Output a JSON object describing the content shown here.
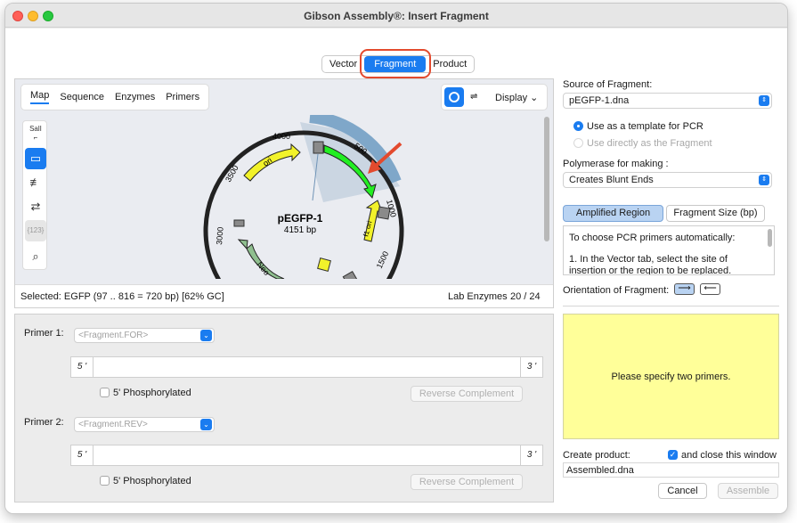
{
  "window": {
    "title": "Gibson Assembly®: Insert Fragment"
  },
  "segments": {
    "vector": "Vector",
    "fragment": "Fragment",
    "product": "Product"
  },
  "map": {
    "tabs": [
      "Map",
      "Sequence",
      "Enzymes",
      "Primers"
    ],
    "display_label": "Display",
    "linear_symbol": "⇌",
    "tool_labels": {
      "sall": "SalI",
      "numbers": "{123}"
    },
    "plasmid_name": "pEGFP-1",
    "plasmid_size": "4151 bp",
    "features": {
      "ori": "ori",
      "neo": "Neo",
      "f1ori": "f1 ori"
    },
    "ticks": {
      "t1000": "1000",
      "t1500": "1500",
      "t3000": "3000",
      "t3500": "3500",
      "t4000": "4000",
      "t500": "500"
    },
    "status_selected": "Selected:  EGFP  (97 .. 816  =  720 bp)     [62% GC]",
    "status_enzymes": "Lab Enzymes",
    "status_count": "20 / 24",
    "colors": {
      "egfp": "#22ee22",
      "ori": "#f2f22a",
      "neo": "#8fbf8f",
      "arc": "#7fa7c9"
    }
  },
  "primers": {
    "primer1_label": "Primer 1:",
    "primer1_placeholder": "<Fragment.FOR>",
    "primer2_label": "Primer 2:",
    "primer2_placeholder": "<Fragment.REV>",
    "five_prime": "5 '",
    "three_prime": "3 '",
    "phosphorylated": "5' Phosphorylated",
    "reverse_complement": "Reverse Complement"
  },
  "right": {
    "source_label": "Source of Fragment:",
    "source_value": "pEGFP-1.dna",
    "radio_template": "Use as a template for PCR",
    "radio_direct": "Use directly as the Fragment",
    "polymerase_label": "Polymerase for making :",
    "polymerase_value": "Creates Blunt Ends",
    "tab_amplified": "Amplified Region",
    "tab_fragment_size": "Fragment Size (bp)",
    "info_line1": "To choose PCR primers automatically:",
    "info_line2": "1. In the Vector tab, select the site of insertion or the region to be replaced.",
    "orientation_label": "Orientation of Fragment:",
    "message": "Please specify two primers.",
    "create_label": "Create product:",
    "close_label": "and close this window",
    "product_name": "Assembled.dna",
    "cancel": "Cancel",
    "assemble": "Assemble"
  }
}
